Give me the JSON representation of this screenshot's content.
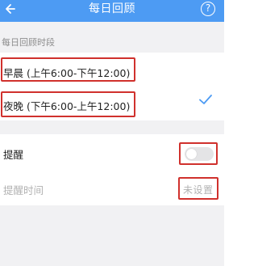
{
  "header": {
    "title": "每日回顾",
    "back_icon": "back-arrow-icon",
    "help_label": "?"
  },
  "section": {
    "label": "每日回顾时段"
  },
  "options": [
    {
      "label": "早晨 (上午6:00-下午12:00)",
      "selected": false
    },
    {
      "label": "夜晚 (下午6:00-上午12:00)",
      "selected": true
    }
  ],
  "reminder": {
    "label": "提醒",
    "enabled": false
  },
  "reminder_time": {
    "label": "提醒时间",
    "value": "未设置"
  },
  "colors": {
    "accent": "#4d9bf3",
    "highlight": "#d0312d"
  }
}
